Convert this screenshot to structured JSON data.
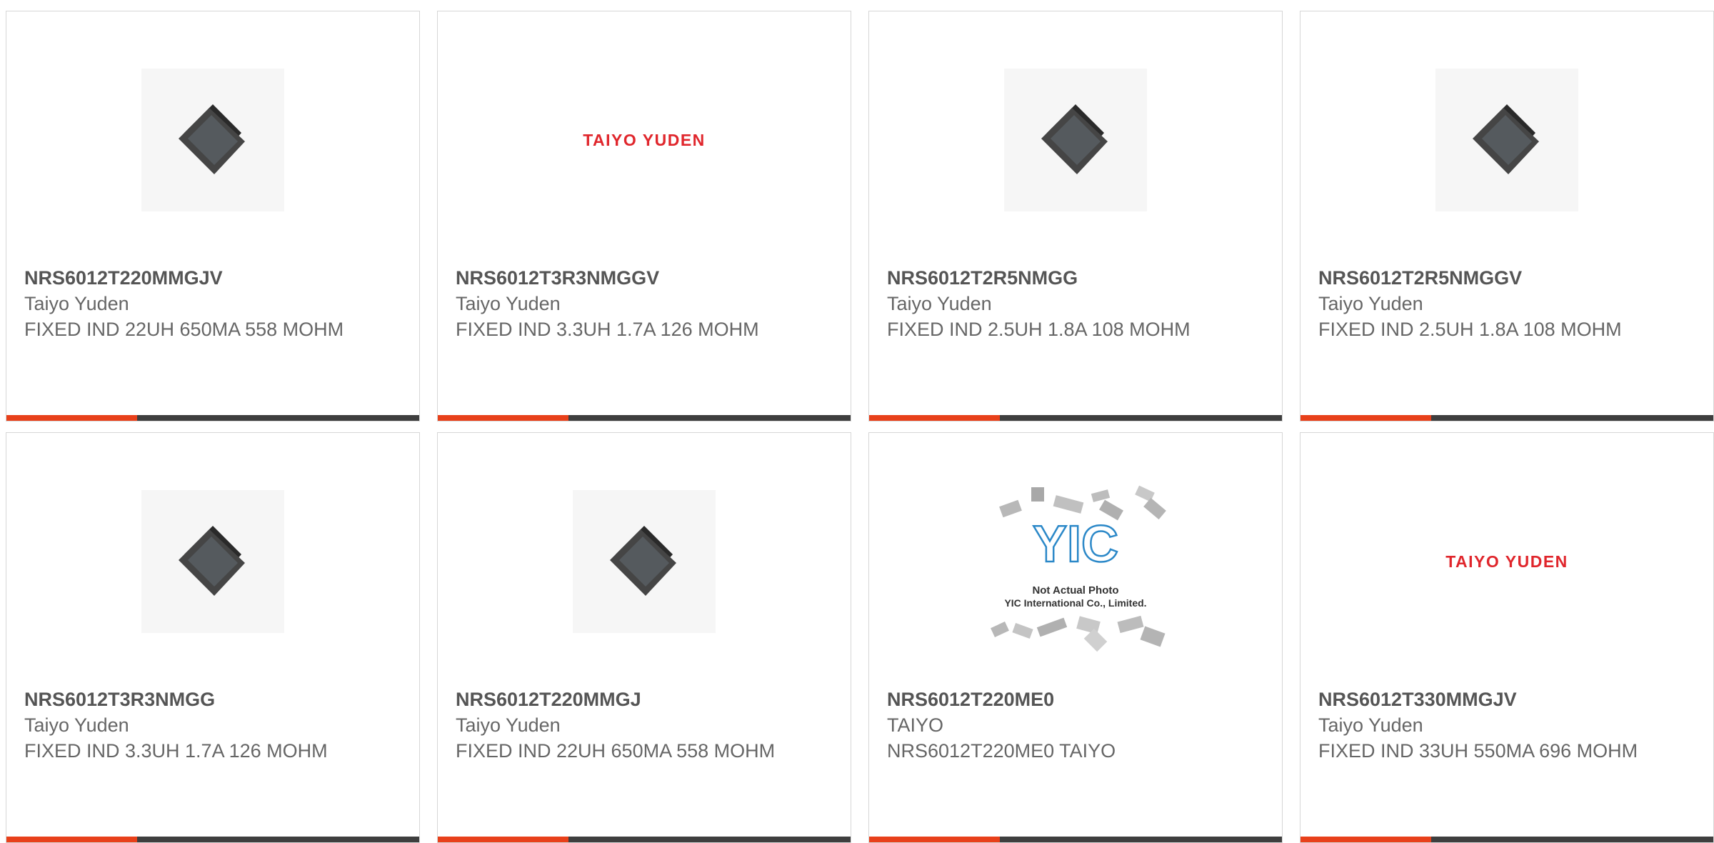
{
  "accent_color": "#e8401a",
  "products": [
    {
      "part_number": "NRS6012T220MMGJV",
      "manufacturer": "Taiyo Yuden",
      "description": "FIXED IND 22UH 650MA 558 MOHM",
      "image": "inductor-photo"
    },
    {
      "part_number": "NRS6012T3R3NMGGV",
      "manufacturer": "Taiyo Yuden",
      "description": "FIXED IND 3.3UH 1.7A 126 MOHM",
      "image": "taiyo-yuden-logo",
      "logo_text": "TAIYO YUDEN"
    },
    {
      "part_number": "NRS6012T2R5NMGG",
      "manufacturer": "Taiyo Yuden",
      "description": "FIXED IND 2.5UH 1.8A 108 MOHM",
      "image": "inductor-photo"
    },
    {
      "part_number": "NRS6012T2R5NMGGV",
      "manufacturer": "Taiyo Yuden",
      "description": "FIXED IND 2.5UH 1.8A 108 MOHM",
      "image": "inductor-photo"
    },
    {
      "part_number": "NRS6012T3R3NMGG",
      "manufacturer": "Taiyo Yuden",
      "description": "FIXED IND 3.3UH 1.7A 126 MOHM",
      "image": "inductor-photo"
    },
    {
      "part_number": "NRS6012T220MMGJ",
      "manufacturer": "Taiyo Yuden",
      "description": "FIXED IND 22UH 650MA 558 MOHM",
      "image": "inductor-photo"
    },
    {
      "part_number": "NRS6012T220ME0",
      "manufacturer": "TAIYO",
      "description": "NRS6012T220ME0 TAIYO",
      "image": "yic-placeholder",
      "placeholder_line1": "Not Actual Photo",
      "placeholder_line2": "YIC International Co., Limited."
    },
    {
      "part_number": "NRS6012T330MMGJV",
      "manufacturer": "Taiyo Yuden",
      "description": "FIXED IND 33UH 550MA 696 MOHM",
      "image": "taiyo-yuden-logo",
      "logo_text": "TAIYO YUDEN"
    }
  ]
}
